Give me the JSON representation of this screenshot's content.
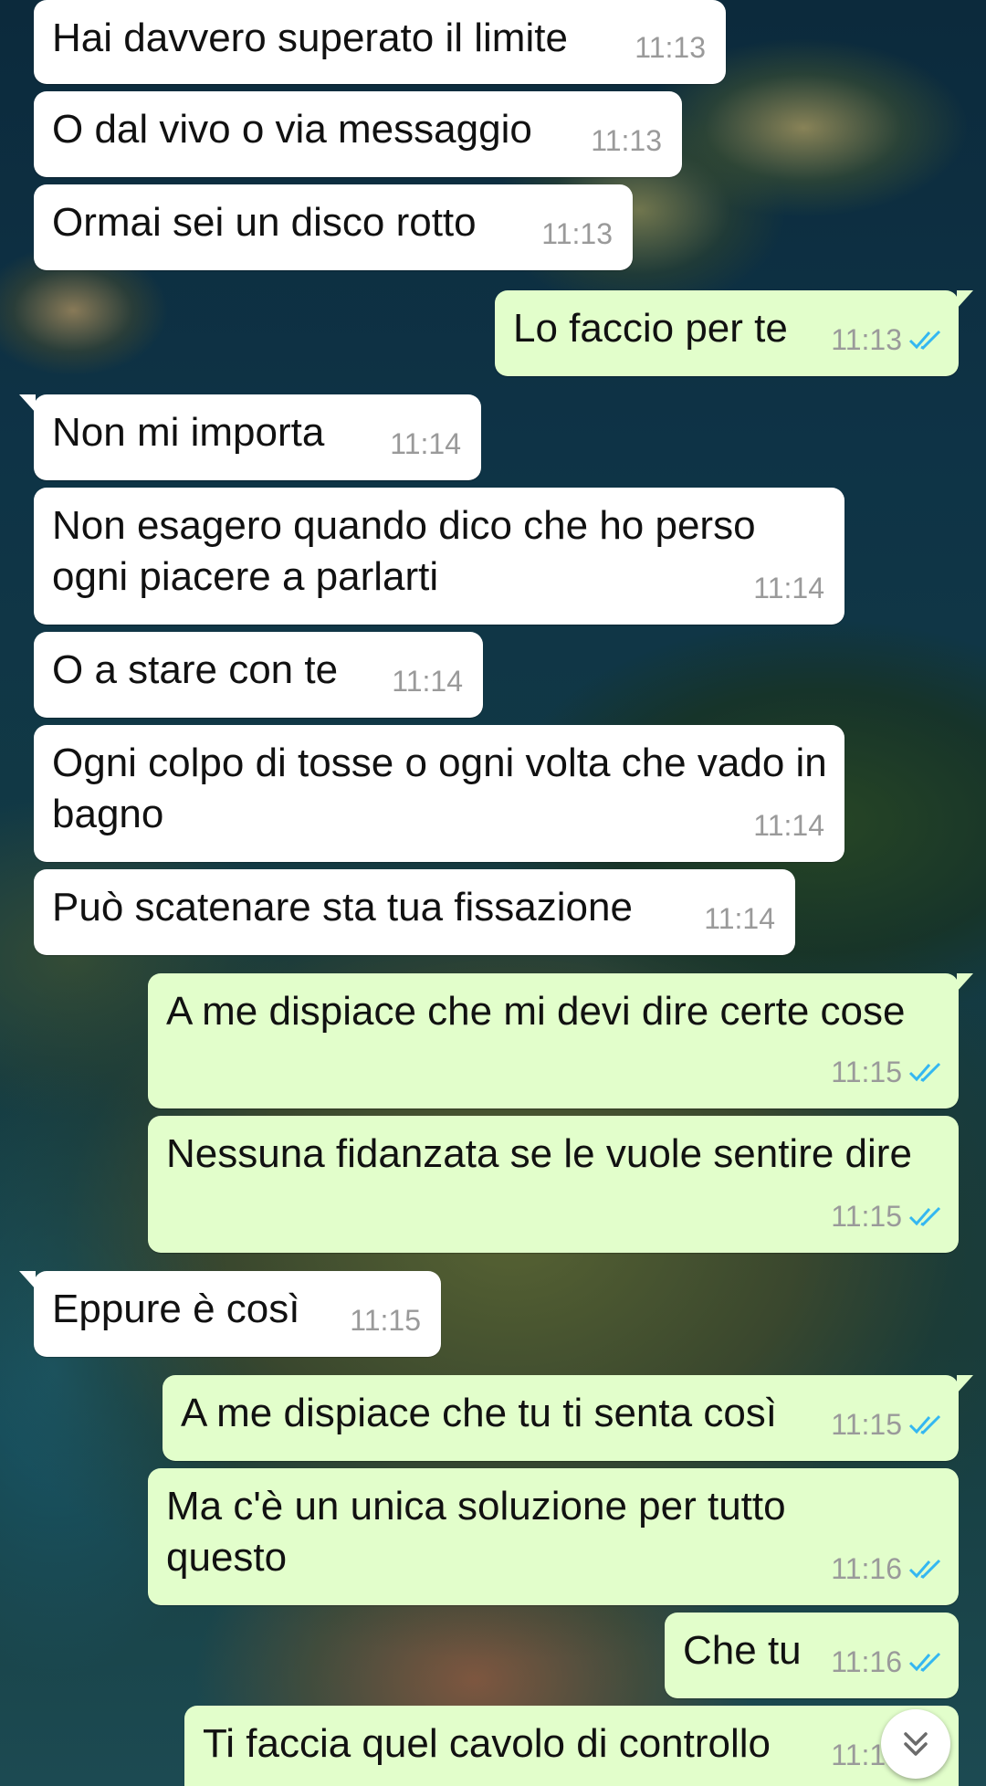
{
  "accent": {
    "incoming_bubble": "#ffffff",
    "outgoing_bubble": "#e2fecb",
    "read_ticks": "#34b7f1",
    "time_text": "#9a9a9a"
  },
  "messages": [
    {
      "direction": "in",
      "text": "Hai davvero superato il limite",
      "time": "11:13"
    },
    {
      "direction": "in",
      "text": "O dal vivo o via messaggio",
      "time": "11:13"
    },
    {
      "direction": "in",
      "text": "Ormai sei un disco rotto",
      "time": "11:13"
    },
    {
      "direction": "out",
      "text": "Lo faccio per te",
      "time": "11:13",
      "status": "read"
    },
    {
      "direction": "in",
      "text": "Non mi importa",
      "time": "11:14"
    },
    {
      "direction": "in",
      "text": "Non esagero quando dico che ho perso ogni piacere a parlarti",
      "time": "11:14"
    },
    {
      "direction": "in",
      "text": "O a stare con te",
      "time": "11:14"
    },
    {
      "direction": "in",
      "text": "Ogni colpo di tosse o ogni volta che vado in bagno",
      "time": "11:14"
    },
    {
      "direction": "in",
      "text": "Può scatenare sta tua fissazione",
      "time": "11:14"
    },
    {
      "direction": "out",
      "text": "A me dispiace che mi devi dire certe cose",
      "time": "11:15",
      "status": "read"
    },
    {
      "direction": "out",
      "text": "Nessuna fidanzata se le vuole sentire dire",
      "time": "11:15",
      "status": "read"
    },
    {
      "direction": "in",
      "text": "Eppure è così",
      "time": "11:15"
    },
    {
      "direction": "out",
      "text": "A me dispiace che tu ti senta così",
      "time": "11:15",
      "status": "read"
    },
    {
      "direction": "out",
      "text": "Ma c'è un unica soluzione per tutto questo",
      "time": "11:16",
      "status": "read"
    },
    {
      "direction": "out",
      "text": "Che tu",
      "time": "11:16",
      "status": "read"
    },
    {
      "direction": "out",
      "text": "Ti faccia quel cavolo di controllo",
      "time": "11:16",
      "status": "read"
    }
  ],
  "scroll_button": {
    "icon": "double-chevron-down-icon"
  }
}
